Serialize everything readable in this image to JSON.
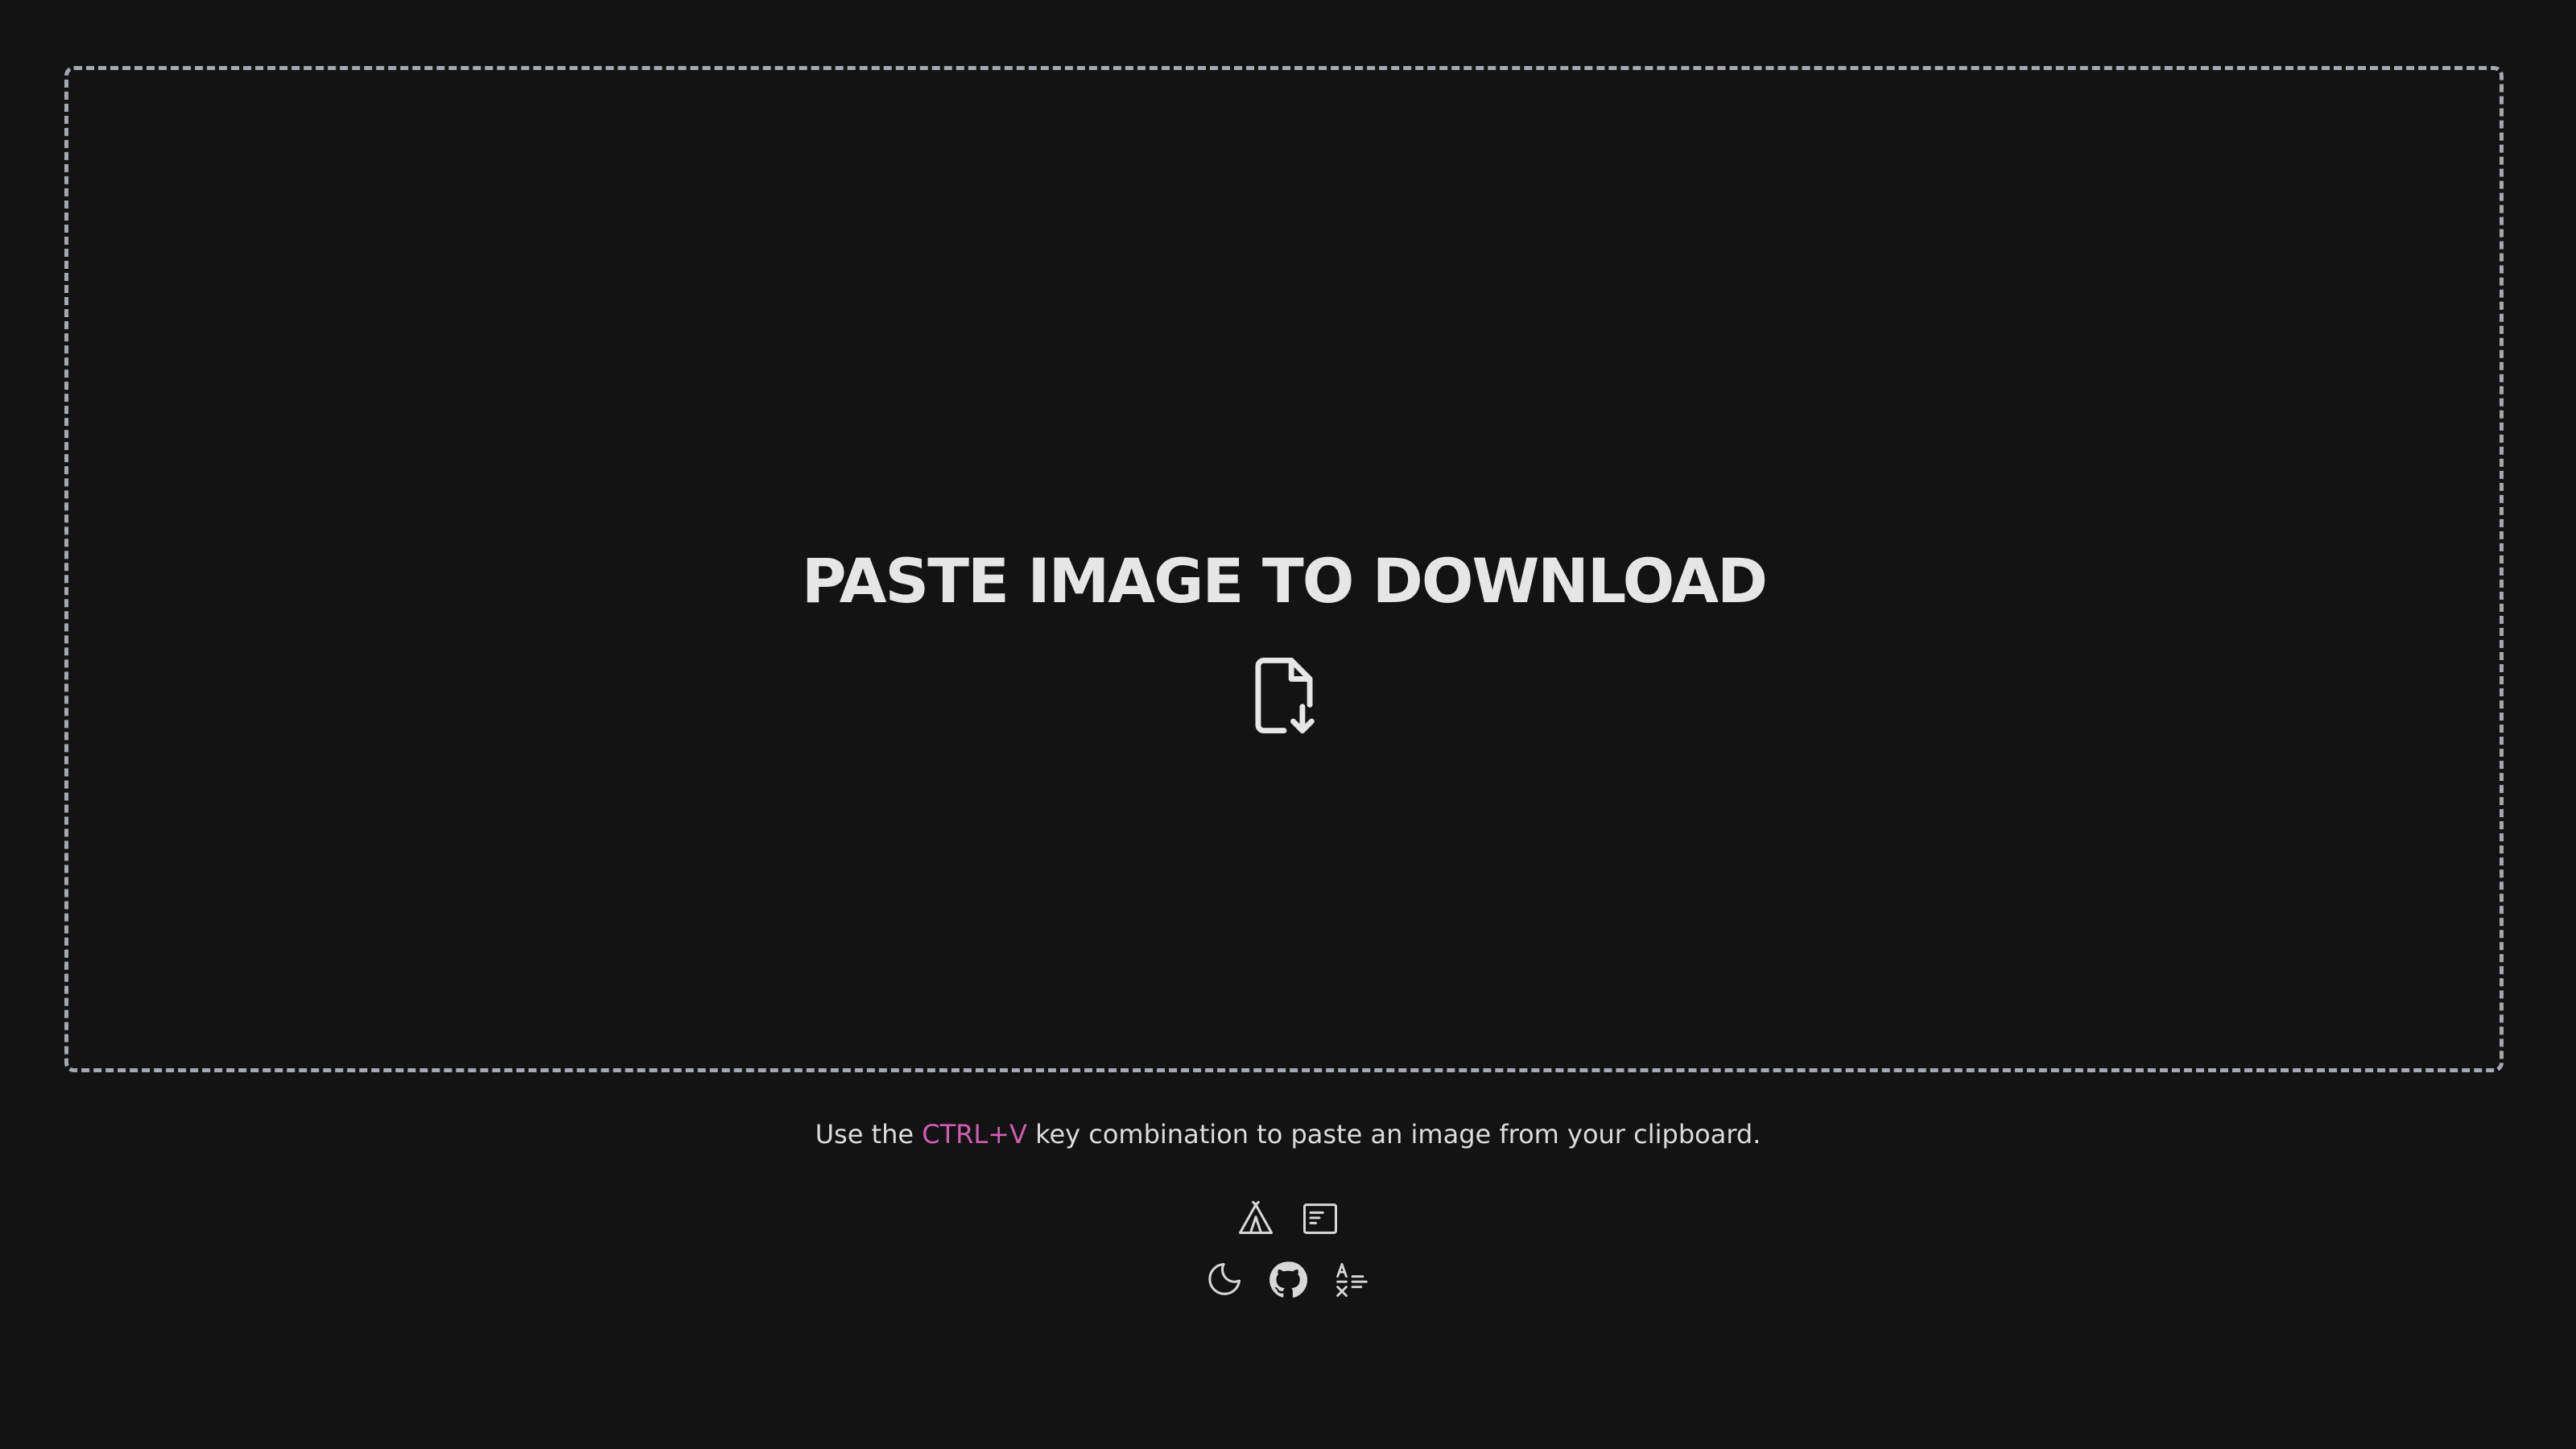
{
  "dropzone": {
    "title": "PASTE IMAGE TO DOWNLOAD",
    "icon": "file-download-icon"
  },
  "hint": {
    "prefix": "Use the",
    "shortcut": "CTRL+V",
    "suffix": "key combination to paste an image from your clipboard."
  },
  "footer": {
    "row1": [
      "camp-tent-icon",
      "article-layout-icon"
    ],
    "row2": [
      "moon-icon",
      "github-icon",
      "language-icon"
    ]
  },
  "colors": {
    "background": "#131313",
    "border": "#a3a8b2",
    "accent": "#d35cb5",
    "text": "#e8e8e8"
  }
}
